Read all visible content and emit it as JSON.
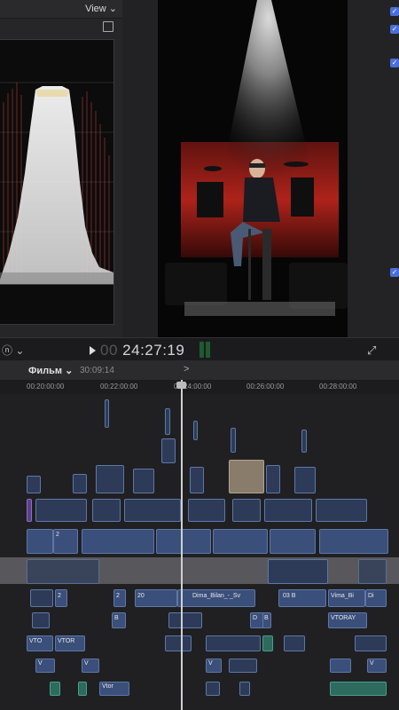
{
  "scopes": {
    "view_label": "View ⌄"
  },
  "transport": {
    "timecode_prefix": "00",
    "timecode": "24:27:19",
    "left_control": "ⓝ ⌄"
  },
  "timeline_header": {
    "project": "Фильм ⌄",
    "duration": "30:09:14",
    "nav": ">"
  },
  "ruler": {
    "ticks": [
      "00:20:00:00",
      "00:22:00:00",
      "00:24:00:00",
      "00:26:00:00",
      "00:28:00:00"
    ]
  },
  "clips": {
    "c1": "2",
    "c2": "2",
    "c3": "20",
    "c4": "D",
    "c5": "Dima_Bilan_-_Sv",
    "c6": "03 B",
    "c7": "Vima_Bi",
    "c8": "Di",
    "c9": "B",
    "c10": "D",
    "c11": "B",
    "c12": "VTORAY",
    "c13": "VTO",
    "c14": "VTOR",
    "c15": "V",
    "c16": "V",
    "c17": "V",
    "c18": "V",
    "c19": "Vtor",
    "c20": "2",
    "c21": "2"
  },
  "colors": {
    "accent": "#4a6fd8",
    "clip": "#3a4f7a",
    "clip_teal": "#2e6a5e",
    "stage_red": "#c0261d"
  }
}
